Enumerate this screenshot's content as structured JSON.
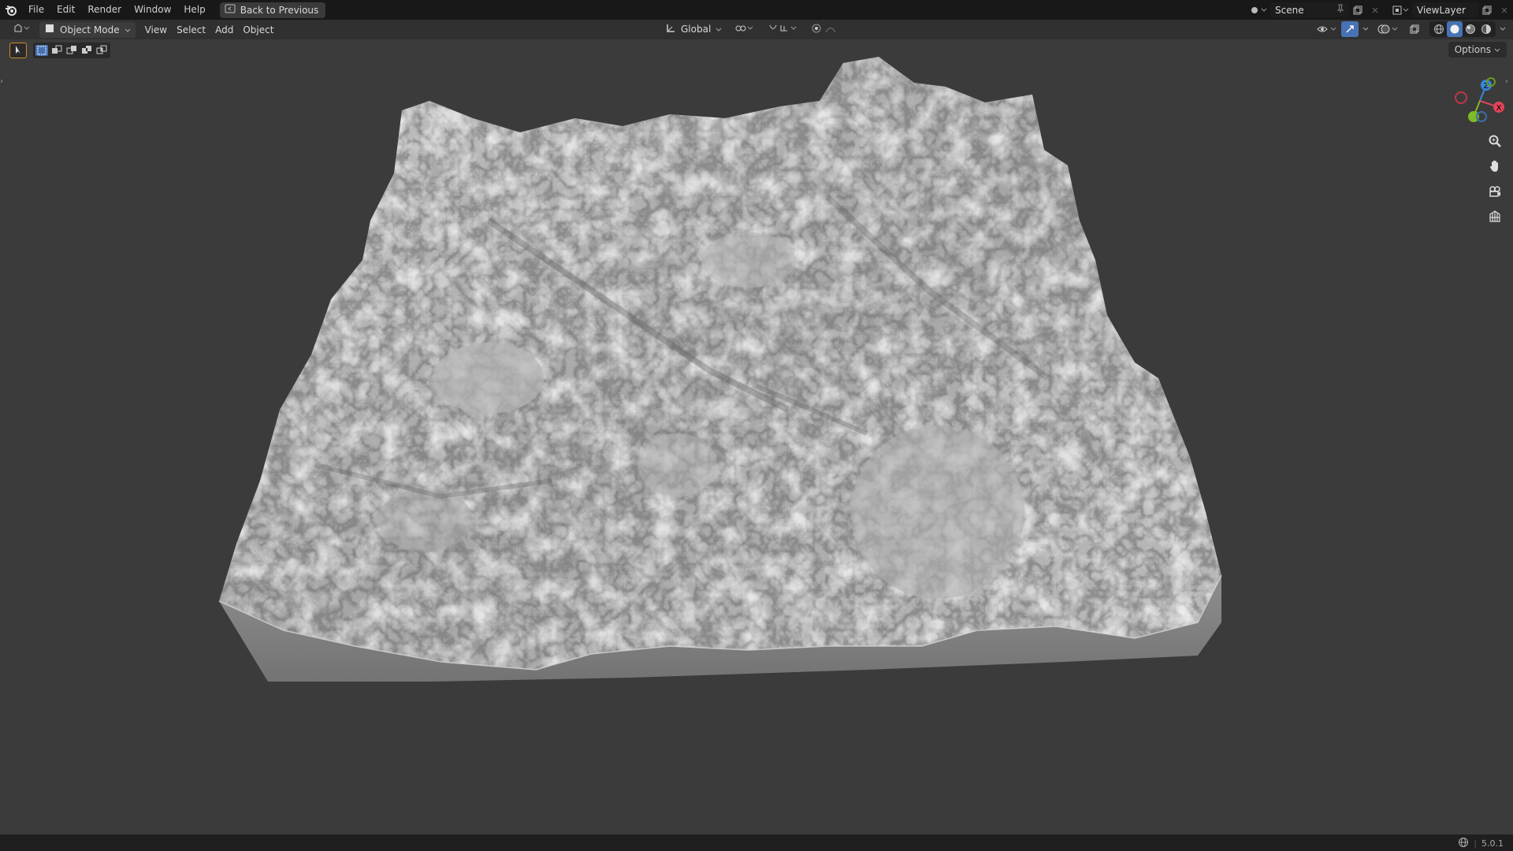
{
  "topbar": {
    "menus": [
      "File",
      "Edit",
      "Render",
      "Window",
      "Help"
    ],
    "back_button": "Back to Previous",
    "scene_name": "Scene",
    "view_layer": "ViewLayer"
  },
  "header": {
    "mode": "Object Mode",
    "menus": [
      "View",
      "Select",
      "Add",
      "Object"
    ],
    "transform_orientation": "Global"
  },
  "viewport": {
    "options_label": "Options",
    "gizmo_axes": [
      "Z",
      "X"
    ]
  },
  "statusbar": {
    "version": "5.0.1"
  },
  "colors": {
    "topbar_bg": "#181818",
    "header_bg": "#303030",
    "viewport_bg": "#3b3b3b",
    "axis_x": "#e0455a",
    "axis_y": "#7ebb26",
    "axis_z": "#3a86d8",
    "active_blue": "#4772b3"
  },
  "icons": [
    "blender-logo",
    "back-icon",
    "scene-icon",
    "pin-icon",
    "new-scene-icon",
    "close-icon",
    "view-layer-icon",
    "editor-type-icon",
    "object-mode-icon",
    "transform-orientation-icon",
    "pivot-icon",
    "snap-icon",
    "proportional-icon",
    "visibility-icon",
    "gizmo-icon",
    "overlay-icon",
    "xray-icon",
    "wireframe-shading-icon",
    "solid-shading-icon",
    "material-shading-icon",
    "rendered-shading-icon",
    "select-tool-icon",
    "zoom-icon",
    "pan-hand-icon",
    "camera-icon",
    "ortho-grid-icon",
    "globe-icon"
  ]
}
